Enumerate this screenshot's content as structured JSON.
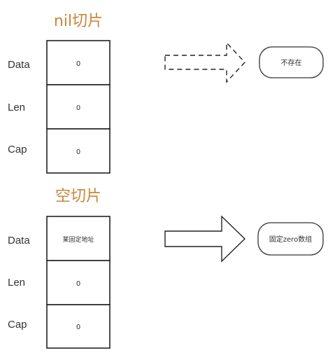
{
  "nil_slice": {
    "title": "nil切片",
    "rows": [
      {
        "label": "Data",
        "value": "0"
      },
      {
        "label": "Len",
        "value": "0"
      },
      {
        "label": "Cap",
        "value": "0"
      }
    ],
    "target": "不存在"
  },
  "empty_slice": {
    "title": "空切片",
    "rows": [
      {
        "label": "Data",
        "value": "某固定地址"
      },
      {
        "label": "Len",
        "value": "0"
      },
      {
        "label": "Cap",
        "value": "0"
      }
    ],
    "target": "固定zero数组"
  }
}
